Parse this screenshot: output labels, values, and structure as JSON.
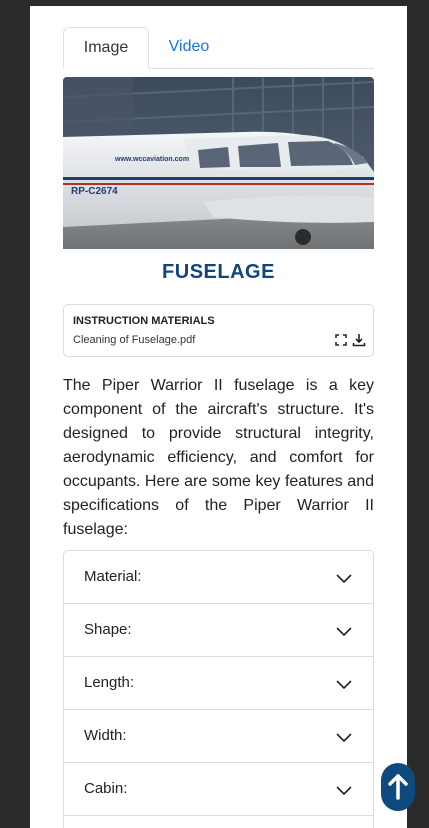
{
  "tabs": [
    {
      "label": "Image"
    },
    {
      "label": "Video"
    }
  ],
  "hero": {
    "registration": "RP-C2674",
    "website": "www.wccaviation.com"
  },
  "section_title": "FUSELAGE",
  "materials": {
    "heading": "INSTRUCTION MATERIALS",
    "file": "Cleaning of Fuselage.pdf"
  },
  "description": "The Piper Warrior II fuselage is a key component of the aircraft's structure. It's designed to provide structural integrity, aerodynamic efficiency, and comfort for occupants. Here are some key features and specifications of the Piper Warrior II fuselage:",
  "accordion": [
    {
      "label": "Material:"
    },
    {
      "label": "Shape:"
    },
    {
      "label": "Length:"
    },
    {
      "label": "Width:"
    },
    {
      "label": "Cabin:"
    }
  ],
  "icons": {
    "expand": "expand-icon",
    "download": "download-icon",
    "chevron": "chevron-down-icon",
    "scroll_top": "arrow-up-icon"
  },
  "colors": {
    "title": "#12467a",
    "tab_link": "#1a73e8",
    "scroll_button": "#0e4a7e"
  }
}
